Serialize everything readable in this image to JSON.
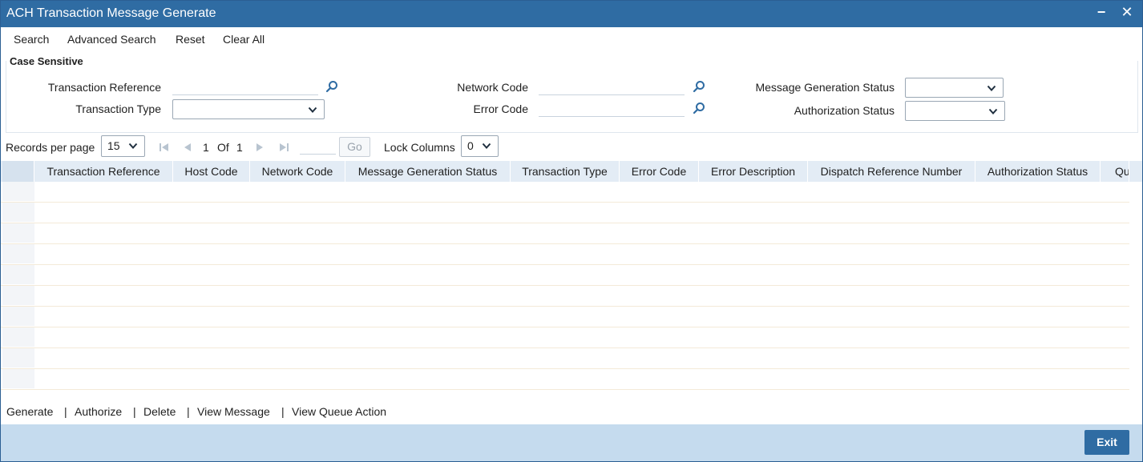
{
  "window": {
    "title": "ACH Transaction Message Generate",
    "minimize_glyph": "−",
    "close_glyph": "✕"
  },
  "toolbar": {
    "search": "Search",
    "advanced_search": "Advanced Search",
    "reset": "Reset",
    "clear_all": "Clear All"
  },
  "criteria": {
    "section_title": "Case Sensitive",
    "transaction_reference": {
      "label": "Transaction Reference",
      "value": ""
    },
    "transaction_type": {
      "label": "Transaction Type",
      "value": ""
    },
    "network_code": {
      "label": "Network Code",
      "value": ""
    },
    "error_code": {
      "label": "Error Code",
      "value": ""
    },
    "message_generation_status": {
      "label": "Message Generation Status",
      "value": ""
    },
    "authorization_status": {
      "label": "Authorization Status",
      "value": ""
    }
  },
  "pager": {
    "records_per_page_label": "Records per page",
    "records_per_page": "15",
    "current_page": "1",
    "of_label": "Of",
    "total_pages": "1",
    "go_label": "Go",
    "lock_columns_label": "Lock Columns",
    "lock_columns": "0"
  },
  "grid": {
    "columns": [
      "Transaction Reference",
      "Host Code",
      "Network Code",
      "Message Generation Status",
      "Transaction Type",
      "Error Code",
      "Error Description",
      "Dispatch Reference Number",
      "Authorization Status",
      "Qu"
    ],
    "rows": []
  },
  "actions": {
    "generate": "Generate",
    "authorize": "Authorize",
    "delete": "Delete",
    "view_message": "View Message",
    "view_queue_action": "View Queue Action",
    "separator": "|"
  },
  "footer": {
    "exit": "Exit"
  },
  "colors": {
    "titlebar": "#2f6ca3",
    "grid_header": "#e3ecf5",
    "footer": "#c5dbee",
    "icon_blue": "#2f6ca3"
  }
}
